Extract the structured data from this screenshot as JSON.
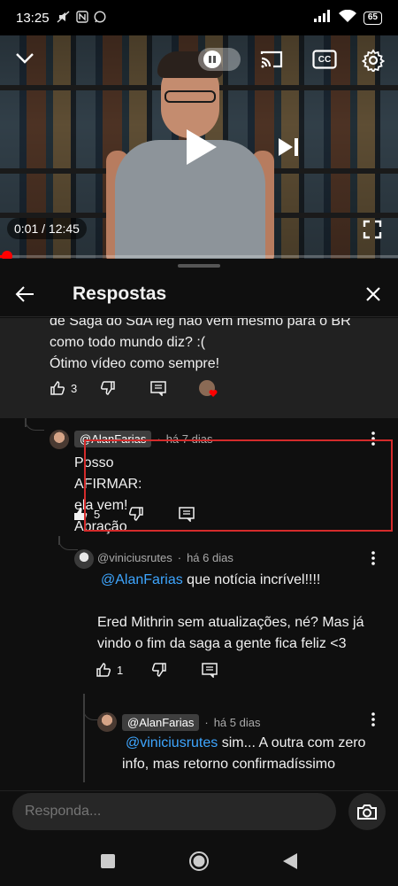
{
  "status_bar": {
    "time": "13:25",
    "battery": "65"
  },
  "video": {
    "time_readout": "0:01 / 12:45",
    "progress": 0.0013,
    "cc_label": "CC"
  },
  "sheet": {
    "title": "Respostas"
  },
  "parent_comment": {
    "lines": [
      "de Saga do SdA leg não vem mesmo para o BR",
      "como todo mundo diz? :(",
      "Ótimo vídeo como sempre!"
    ],
    "likes": "3"
  },
  "replies": [
    {
      "handle": "@AlanFarias",
      "time": "há 7 dias",
      "lines": [
        "Posso AFIRMAR: ela vem!",
        "Abração"
      ],
      "likes": "5"
    },
    {
      "handle": "@viniciusrutes",
      "time": "há 6 dias",
      "mention": "@AlanFarias",
      "first_line": " que notícia incrível!!!!",
      "lines": [
        "Ered Mithrin sem atualizações, né? Mas já",
        "vindo o fim da saga a gente fica feliz <3"
      ],
      "likes": "1"
    },
    {
      "handle": "@AlanFarias",
      "time": "há 5 dias",
      "mention": "@viniciusrutes",
      "first_line": " sim... A outra com zero",
      "lines": [
        "info, mas retorno confirmadíssimo"
      ]
    }
  ],
  "composer": {
    "placeholder": "Responda..."
  },
  "colors": {
    "accent_red": "#ff0000",
    "mention_blue": "#3ea6ff",
    "highlight_border": "#d42b2b"
  }
}
